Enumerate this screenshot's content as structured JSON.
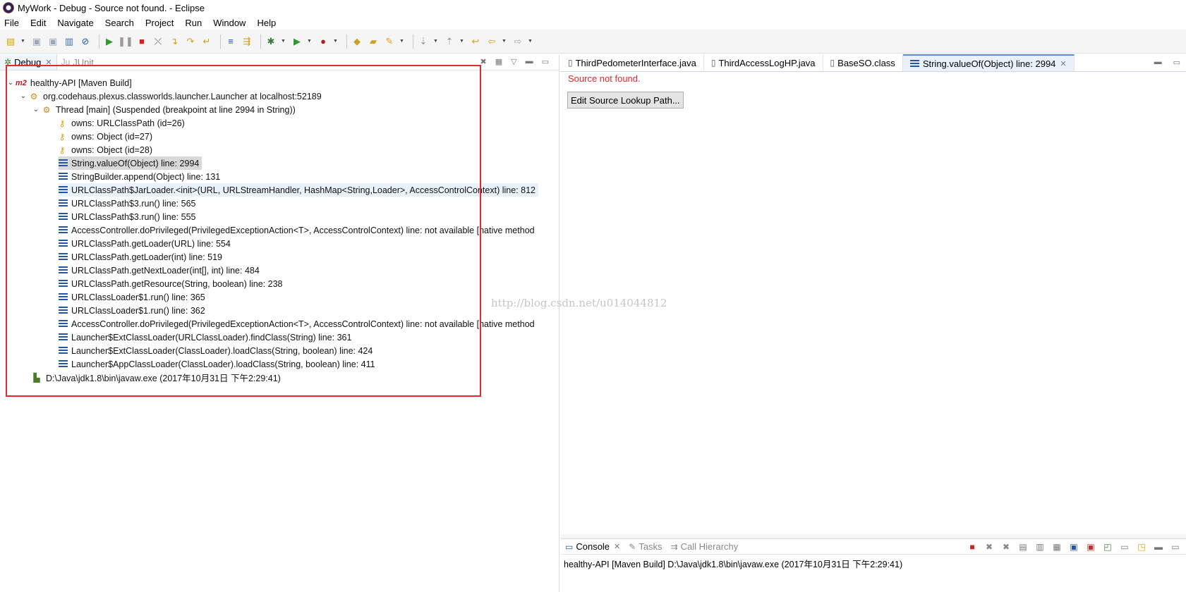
{
  "window": {
    "title": "MyWork - Debug - Source not found. - Eclipse",
    "icon": "eclipse-icon"
  },
  "menu": [
    "File",
    "Edit",
    "Navigate",
    "Search",
    "Project",
    "Run",
    "Window",
    "Help"
  ],
  "debug_view": {
    "tabs": [
      {
        "label": "Debug",
        "icon": "bug-icon",
        "active": true
      },
      {
        "label": "JUnit",
        "icon": "junit-icon",
        "active": false
      }
    ],
    "tree": [
      {
        "label": "healthy-API [Maven Build]",
        "icon": "maven-m2-icon",
        "level": 0,
        "twisty": "open"
      },
      {
        "label": "org.codehaus.plexus.classworlds.launcher.Launcher at localhost:52189",
        "icon": "debug-target-icon",
        "level": 1,
        "twisty": "open"
      },
      {
        "label": "Thread [main] (Suspended (breakpoint at line 2994 in String))",
        "icon": "suspended-thread-icon",
        "level": 2,
        "twisty": "open"
      },
      {
        "label": "owns: URLClassPath  (id=26)",
        "icon": "monitor-key-icon",
        "level": 3
      },
      {
        "label": "owns: Object  (id=27)",
        "icon": "monitor-key-icon",
        "level": 3
      },
      {
        "label": "owns: Object  (id=28)",
        "icon": "monitor-key-icon",
        "level": 3
      },
      {
        "label": "String.valueOf(Object) line: 2994",
        "icon": "stack-frame-icon",
        "level": 3,
        "state": "selected"
      },
      {
        "label": "StringBuilder.append(Object) line: 131",
        "icon": "stack-frame-icon",
        "level": 3
      },
      {
        "label": "URLClassPath$JarLoader.<init>(URL, URLStreamHandler, HashMap<String,Loader>, AccessControlContext) line: 812",
        "icon": "stack-frame-icon",
        "level": 3,
        "state": "hover"
      },
      {
        "label": "URLClassPath$3.run() line: 565",
        "icon": "stack-frame-icon",
        "level": 3
      },
      {
        "label": "URLClassPath$3.run() line: 555",
        "icon": "stack-frame-icon",
        "level": 3
      },
      {
        "label": "AccessController.doPrivileged(PrivilegedExceptionAction<T>, AccessControlContext) line: not available [native method",
        "icon": "stack-frame-icon",
        "level": 3
      },
      {
        "label": "URLClassPath.getLoader(URL) line: 554",
        "icon": "stack-frame-icon",
        "level": 3
      },
      {
        "label": "URLClassPath.getLoader(int) line: 519",
        "icon": "stack-frame-sync-icon",
        "level": 3
      },
      {
        "label": "URLClassPath.getNextLoader(int[], int) line: 484",
        "icon": "stack-frame-sync-icon",
        "level": 3
      },
      {
        "label": "URLClassPath.getResource(String, boolean) line: 238",
        "icon": "stack-frame-icon",
        "level": 3
      },
      {
        "label": "URLClassLoader$1.run() line: 365",
        "icon": "stack-frame-icon",
        "level": 3
      },
      {
        "label": "URLClassLoader$1.run() line: 362",
        "icon": "stack-frame-icon",
        "level": 3
      },
      {
        "label": "AccessController.doPrivileged(PrivilegedExceptionAction<T>, AccessControlContext) line: not available [native method",
        "icon": "stack-frame-icon",
        "level": 3
      },
      {
        "label": "Launcher$ExtClassLoader(URLClassLoader).findClass(String) line: 361",
        "icon": "stack-frame-icon",
        "level": 3
      },
      {
        "label": "Launcher$ExtClassLoader(ClassLoader).loadClass(String, boolean) line: 424",
        "icon": "stack-frame-icon",
        "level": 3
      },
      {
        "label": "Launcher$AppClassLoader(ClassLoader).loadClass(String, boolean) line: 411",
        "icon": "stack-frame-icon",
        "level": 3
      },
      {
        "label": "D:\\Java\\jdk1.8\\bin\\javaw.exe (2017年10月31日 下午2:29:41)",
        "icon": "process-icon",
        "level": 1
      }
    ]
  },
  "editor": {
    "tabs": [
      {
        "label": "ThirdPedometerInterface.java",
        "icon": "java-file-icon",
        "active": false
      },
      {
        "label": "ThirdAccessLogHP.java",
        "icon": "java-file-icon",
        "active": false
      },
      {
        "label": "BaseSO.class",
        "icon": "class-file-icon",
        "active": false
      },
      {
        "label": "String.valueOf(Object) line: 2994",
        "icon": "stack-frame-icon",
        "active": true
      }
    ],
    "message": "Source not found.",
    "button_label": "Edit Source Lookup Path..."
  },
  "console": {
    "tabs": [
      {
        "label": "Console",
        "icon": "console-icon",
        "active": true
      },
      {
        "label": "Tasks",
        "icon": "tasks-icon",
        "active": false
      },
      {
        "label": "Call Hierarchy",
        "icon": "call-hierarchy-icon",
        "active": false
      }
    ],
    "line": "healthy-API [Maven Build] D:\\Java\\jdk1.8\\bin\\javaw.exe (2017年10月31日 下午2:29:41)"
  },
  "watermark": "http://blog.csdn.net/u014044812",
  "colors": {
    "highlight_box": "#e8262e",
    "error_text": "#e8262e",
    "frame_icon": "#2456a6"
  }
}
